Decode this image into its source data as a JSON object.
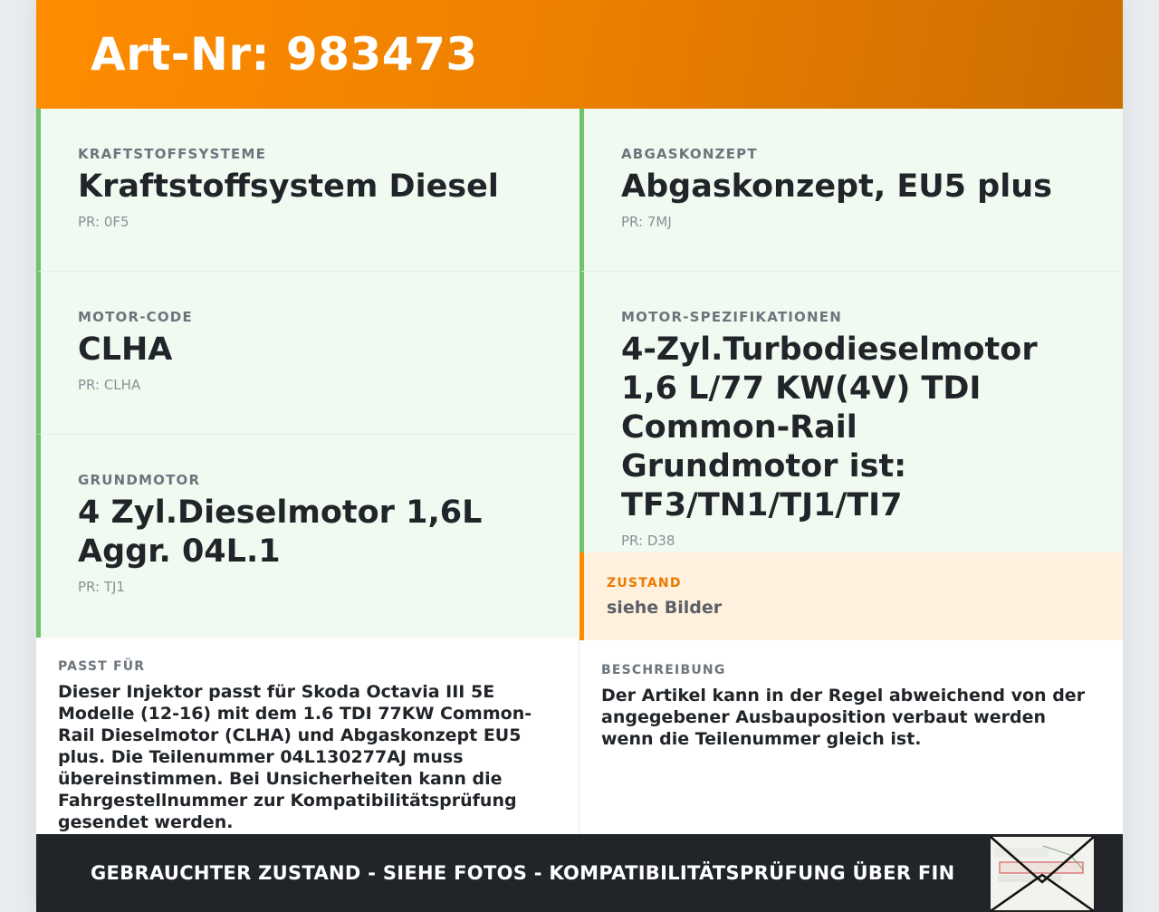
{
  "header": {
    "title": "Art-Nr: 983473"
  },
  "specs": {
    "kraftstoff": {
      "label": "KRAFTSTOFFSYSTEME",
      "value": "Kraftstoffsystem Diesel",
      "pr": "PR: 0F5"
    },
    "abgas": {
      "label": "ABGASKONZEPT",
      "value": "Abgaskonzept, EU5 plus",
      "pr": "PR: 7MJ"
    },
    "motorcode": {
      "label": "MOTOR-CODE",
      "value": "CLHA",
      "pr": "PR: CLHA"
    },
    "motorspez": {
      "label": "MOTOR-SPEZIFIKATIONEN",
      "value": "4-Zyl.Turbodieselmotor 1,6 L/77 KW(4V) TDI Common-Rail Grundmotor ist: TF3/TN1/TJ1/TI7",
      "pr": "PR: D38"
    },
    "grundmotor": {
      "label": "GRUNDMOTOR",
      "value": "4 Zyl.Dieselmotor 1,6L Aggr. 04L.1",
      "pr": "PR: TJ1"
    }
  },
  "zustand": {
    "label": "ZUSTAND",
    "value": "siehe Bilder"
  },
  "passt_fuer": {
    "label": "PASST FÜR",
    "text": "Dieser Injektor passt für Skoda Octavia III 5E Modelle (12-16) mit dem 1.6 TDI 77KW Common-Rail Dieselmotor (CLHA) und Abgaskonzept EU5 plus. Die Teilenummer 04L130277AJ muss übereinstimmen. Bei Unsicherheiten kann die Fahrgestellnummer zur Kompatibilitätsprüfung gesendet werden."
  },
  "beschreibung": {
    "label": "BESCHREIBUNG",
    "text": "Der Artikel kann in der Regel abweichend von der angegebener Ausbauposition verbaut werden wenn die Teilenummer gleich ist."
  },
  "footer": {
    "text": "GEBRAUCHTER ZUSTAND - SIEHE FOTOS - KOMPATIBILITÄTSPRÜFUNG ÜBER FIN"
  },
  "colors": {
    "accent": "#ff8c00",
    "green_border": "#6cc46c",
    "green_bg": "#f0faf0",
    "orange_bg": "#fff1de",
    "footer_bg": "#212529"
  },
  "icons": {
    "envelope": "envelope-thumbnail-icon"
  }
}
